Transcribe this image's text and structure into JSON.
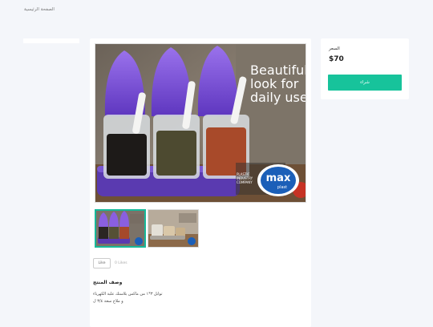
{
  "nav": {
    "home_link": "الصفحة الرئيسية"
  },
  "product": {
    "hero_banner": [
      "Beautiful",
      "look for",
      "daily use"
    ],
    "brand_logo_main": "max",
    "brand_logo_sub": "plast",
    "brand_tagline": [
      "PLASTIC",
      "INDUSTRY",
      "COMPANY"
    ],
    "likes_button_label": "Like",
    "likes_count_text": "0 Likes",
    "description_title": "وصف المنتج",
    "description_lines": [
      "توابل ٣*١ من ماكس بلاستك علبة الكهرباء",
      "و ملاح سعة ٣/٤ ل"
    ]
  },
  "purchase": {
    "price_label": "السعر",
    "price_value": "$70",
    "buy_button_label": "شراء"
  },
  "colors": {
    "accent": "#17c39b",
    "lid_purple": "#7b4fd4",
    "tray_purple": "#5a3ab0",
    "background": "#f4f6fa"
  }
}
